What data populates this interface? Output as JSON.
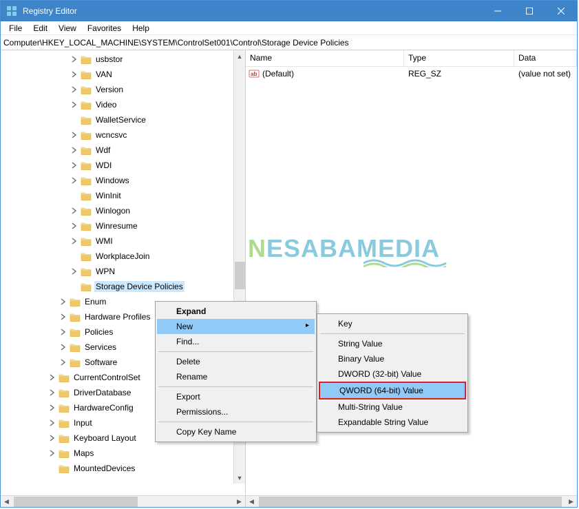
{
  "titlebar": {
    "title": "Registry Editor"
  },
  "menubar": {
    "items": [
      "File",
      "Edit",
      "View",
      "Favorites",
      "Help"
    ]
  },
  "addressbar": {
    "path": "Computer\\HKEY_LOCAL_MACHINE\\SYSTEM\\ControlSet001\\Control\\Storage Device Policies"
  },
  "tree": {
    "items": [
      {
        "indent": 6,
        "label": "usbstor",
        "expander": ">"
      },
      {
        "indent": 6,
        "label": "VAN",
        "expander": ">"
      },
      {
        "indent": 6,
        "label": "Version",
        "expander": ">"
      },
      {
        "indent": 6,
        "label": "Video",
        "expander": ">"
      },
      {
        "indent": 6,
        "label": "WalletService",
        "expander": ""
      },
      {
        "indent": 6,
        "label": "wcncsvc",
        "expander": ">"
      },
      {
        "indent": 6,
        "label": "Wdf",
        "expander": ">"
      },
      {
        "indent": 6,
        "label": "WDI",
        "expander": ">"
      },
      {
        "indent": 6,
        "label": "Windows",
        "expander": ">"
      },
      {
        "indent": 6,
        "label": "WinInit",
        "expander": ""
      },
      {
        "indent": 6,
        "label": "Winlogon",
        "expander": ">"
      },
      {
        "indent": 6,
        "label": "Winresume",
        "expander": ">"
      },
      {
        "indent": 6,
        "label": "WMI",
        "expander": ">"
      },
      {
        "indent": 6,
        "label": "WorkplaceJoin",
        "expander": ""
      },
      {
        "indent": 6,
        "label": "WPN",
        "expander": ">"
      },
      {
        "indent": 6,
        "label": "Storage Device Policies",
        "expander": "",
        "selected": true
      },
      {
        "indent": 5,
        "label": "Enum",
        "expander": ">"
      },
      {
        "indent": 5,
        "label": "Hardware Profiles",
        "expander": ">"
      },
      {
        "indent": 5,
        "label": "Policies",
        "expander": ">"
      },
      {
        "indent": 5,
        "label": "Services",
        "expander": ">"
      },
      {
        "indent": 5,
        "label": "Software",
        "expander": ">"
      },
      {
        "indent": 4,
        "label": "CurrentControlSet",
        "expander": ">"
      },
      {
        "indent": 4,
        "label": "DriverDatabase",
        "expander": ">"
      },
      {
        "indent": 4,
        "label": "HardwareConfig",
        "expander": ">"
      },
      {
        "indent": 4,
        "label": "Input",
        "expander": ">"
      },
      {
        "indent": 4,
        "label": "Keyboard Layout",
        "expander": ">"
      },
      {
        "indent": 4,
        "label": "Maps",
        "expander": ">"
      },
      {
        "indent": 4,
        "label": "MountedDevices",
        "expander": ""
      }
    ]
  },
  "values": {
    "headers": {
      "name": "Name",
      "type": "Type",
      "data": "Data"
    },
    "rows": [
      {
        "name": "(Default)",
        "type": "REG_SZ",
        "data": "(value not set)"
      }
    ]
  },
  "context_menu_1": {
    "items": [
      {
        "label": "Expand",
        "bold": true
      },
      {
        "label": "New",
        "highlighted": true,
        "has_sub": true
      },
      {
        "label": "Find..."
      },
      {
        "sep": true
      },
      {
        "label": "Delete"
      },
      {
        "label": "Rename"
      },
      {
        "sep": true
      },
      {
        "label": "Export"
      },
      {
        "label": "Permissions..."
      },
      {
        "sep": true
      },
      {
        "label": "Copy Key Name"
      }
    ]
  },
  "context_menu_2": {
    "items": [
      {
        "label": "Key"
      },
      {
        "sep": true
      },
      {
        "label": "String Value"
      },
      {
        "label": "Binary Value"
      },
      {
        "label": "DWORD (32-bit) Value"
      },
      {
        "label": "QWORD (64-bit) Value",
        "highlighted": true,
        "outlined": true
      },
      {
        "label": "Multi-String Value"
      },
      {
        "label": "Expandable String Value"
      }
    ]
  },
  "watermark": {
    "first": "N",
    "rest": "ESABAMEDIA"
  }
}
